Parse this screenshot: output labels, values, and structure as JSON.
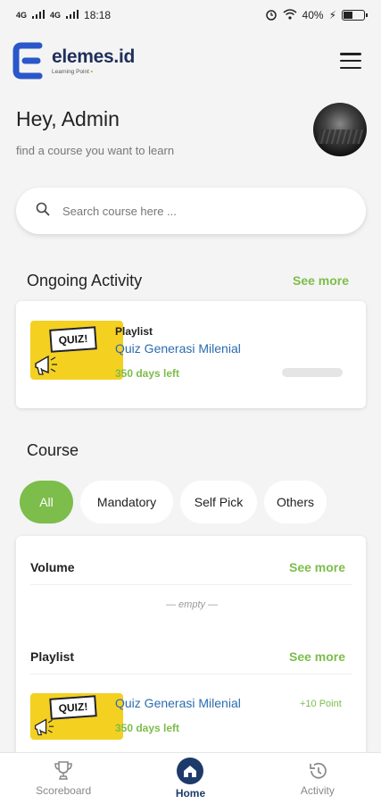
{
  "status_bar": {
    "left_signal_1": "4G",
    "left_signal_2": "4G",
    "time": "18:18",
    "battery": "40%",
    "battery_level": 0.4
  },
  "header": {
    "brand_name": "elemes.id",
    "brand_tagline": "Learning Point"
  },
  "greeting": {
    "title": "Hey, Admin",
    "subtitle": "find a course you want to learn"
  },
  "search": {
    "placeholder": "Search course here ...",
    "value": ""
  },
  "ongoing": {
    "title": "Ongoing Activity",
    "see_more": "See more",
    "item": {
      "type": "Playlist",
      "title": "Quiz Generasi Milenial",
      "days_left": "350 days left",
      "thumb_text": "QUIZ!",
      "progress": 0
    }
  },
  "course": {
    "title": "Course",
    "chips": [
      "All",
      "Mandatory",
      "Self Pick",
      "Others"
    ],
    "active_chip": "All",
    "volume": {
      "label": "Volume",
      "see_more": "See more",
      "empty": "— empty —"
    },
    "playlist": {
      "label": "Playlist",
      "see_more": "See more",
      "item": {
        "title": "Quiz Generasi Milenial",
        "days_left": "350 days left",
        "point": "+10 Point",
        "thumb_text": "QUIZ!"
      }
    }
  },
  "bottom_nav": {
    "items": [
      {
        "label": "Scoreboard",
        "icon": "trophy-icon"
      },
      {
        "label": "Home",
        "icon": "home-icon"
      },
      {
        "label": "Activity",
        "icon": "history-icon"
      }
    ],
    "active": "Home"
  },
  "colors": {
    "accent_green": "#7cbd4b",
    "brand_navy": "#1e3a6a",
    "link_blue": "#2b6cb0",
    "thumb_yellow": "#f4d021"
  }
}
